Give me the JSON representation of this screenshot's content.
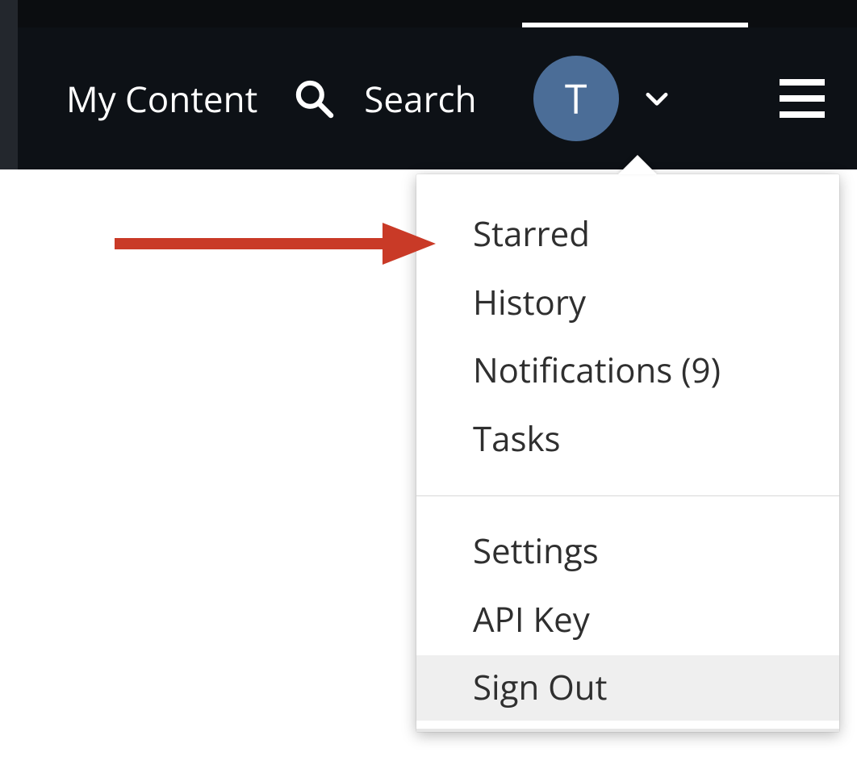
{
  "colors": {
    "navbar_bg": "#0d1116",
    "avatar_bg": "#4b6d97",
    "annotation": "#c93a27"
  },
  "navbar": {
    "my_content_label": "My Content",
    "search_label": "Search",
    "avatar_initial": "T"
  },
  "dropdown": {
    "section1": {
      "starred": "Starred",
      "history": "History",
      "notifications": "Notifications (9)",
      "tasks": "Tasks"
    },
    "section2": {
      "settings": "Settings",
      "api_key": "API Key",
      "sign_out": "Sign Out"
    }
  },
  "annotation": {
    "points_to": "starred-menu-item"
  }
}
